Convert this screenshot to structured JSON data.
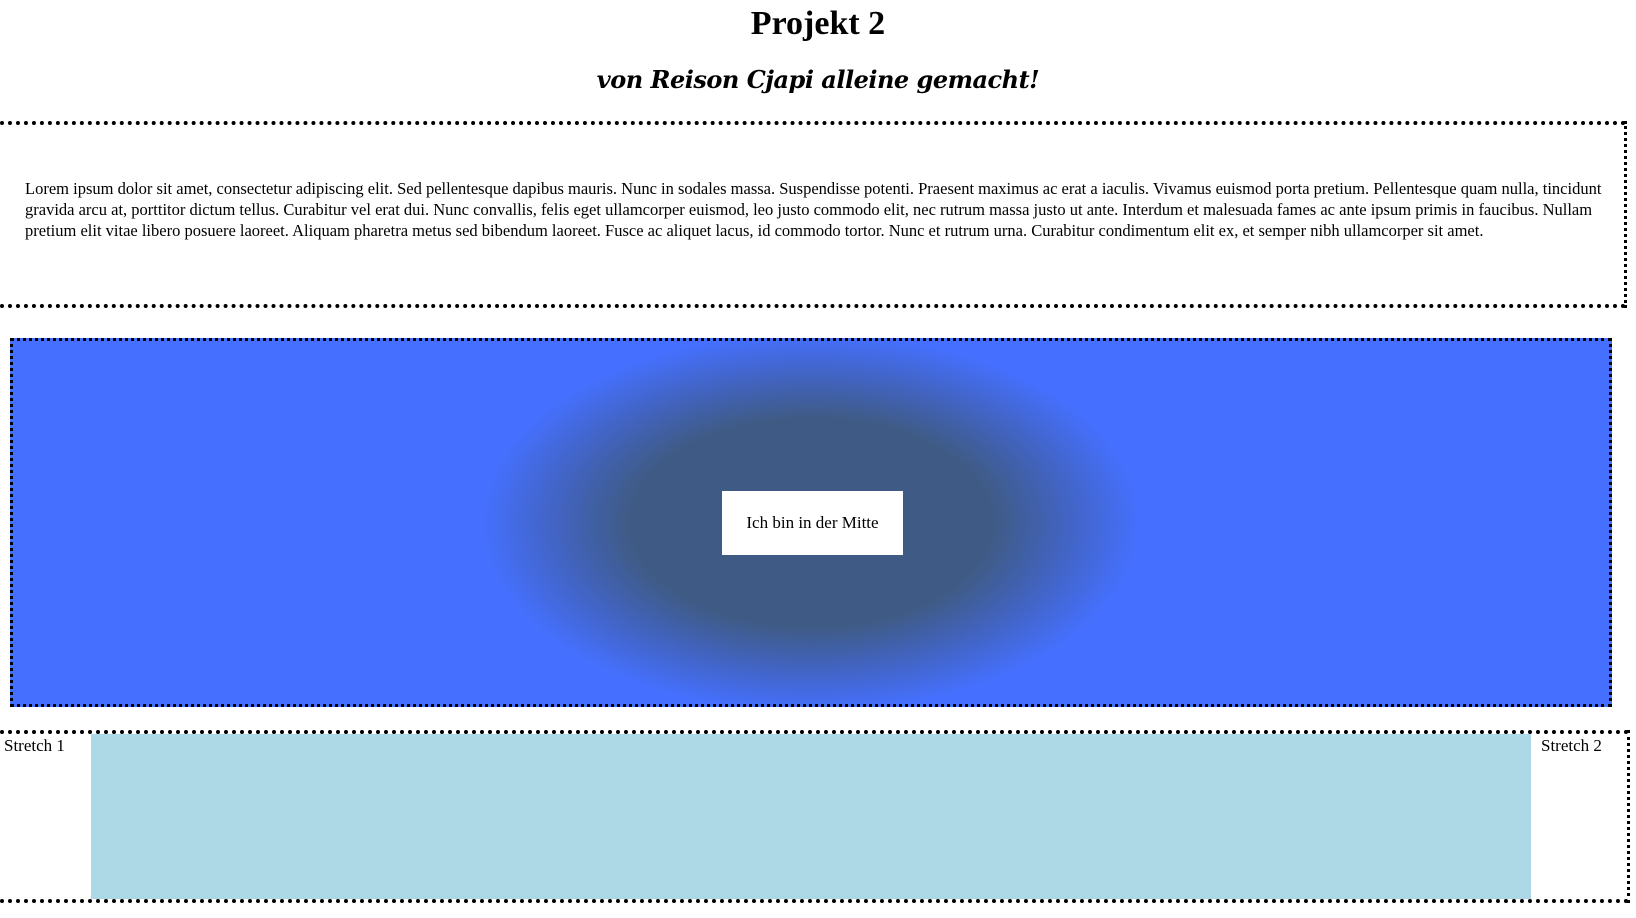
{
  "header": {
    "title": "Projekt 2",
    "subtitle": "von Reison Cjapi alleine gemacht!"
  },
  "text_section": {
    "paragraph": "Lorem ipsum dolor sit amet, consectetur adipiscing elit. Sed pellentesque dapibus mauris. Nunc in sodales massa. Suspendisse potenti. Praesent maximus ac erat a iaculis. Vivamus euismod porta pretium. Pellentesque quam nulla, tincidunt gravida arcu at, porttitor dictum tellus. Curabitur vel erat dui. Nunc convallis, felis eget ullamcorper euismod, leo justo commodo elit, nec rutrum massa justo ut ante. Interdum et malesuada fames ac ante ipsum primis in faucibus. Nullam pretium elit vitae libero posuere laoreet. Aliquam pharetra metus sed bibendum laoreet. Fusce ac aliquet lacus, id commodo tortor. Nunc et rutrum urna. Curabitur condimentum elit ex, et semper nibh ullamcorper sit amet."
  },
  "center_section": {
    "label": "Ich bin in der Mitte",
    "colors": {
      "outer": "#4570ff",
      "inner": "#3f5b85"
    }
  },
  "stretch_section": {
    "left_label": "Stretch 1",
    "right_label": "Stretch 2",
    "middle_color": "#add8e6"
  }
}
